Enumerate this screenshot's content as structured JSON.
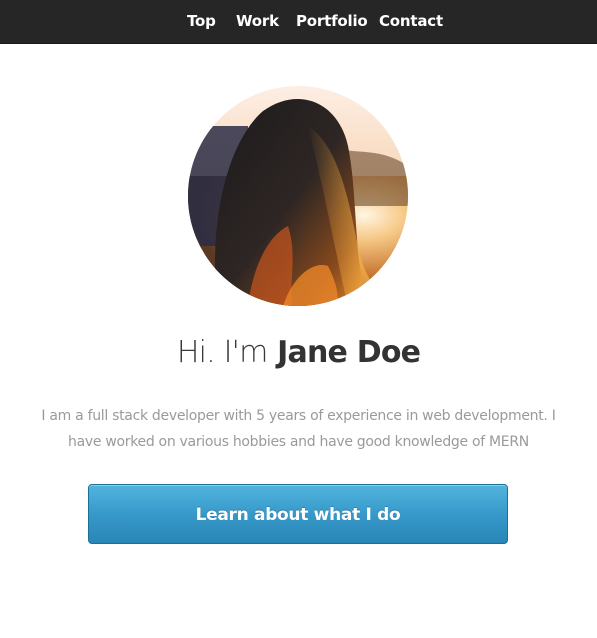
{
  "nav": {
    "items": [
      {
        "label": "Top"
      },
      {
        "label": "Work"
      },
      {
        "label": "Portfolio"
      },
      {
        "label": "Contact"
      }
    ]
  },
  "hero": {
    "greeting": "Hi. I'm",
    "name": "Jane Doe",
    "bio": "I am a full stack developer with 5 years of experience in web development. I have worked on various hobbies and have good knowledge of MERN",
    "cta_label": "Learn about what I do"
  },
  "colors": {
    "navbar": "#262626",
    "accent": "#3597c8",
    "text": "#333333",
    "muted": "#9a9a9a"
  }
}
